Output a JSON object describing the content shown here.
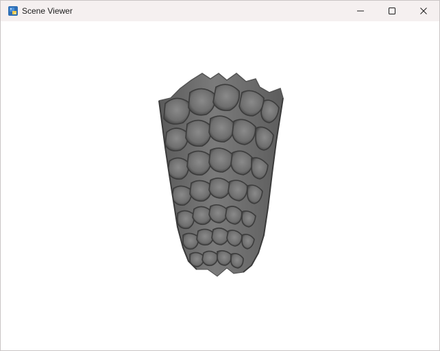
{
  "window": {
    "title": "Scene Viewer",
    "app_icon": "python-app-icon",
    "controls": {
      "minimize_icon": "minimize-icon",
      "maximize_icon": "maximize-icon",
      "close_icon": "close-icon"
    }
  },
  "viewport": {
    "background": "#ffffff",
    "model": {
      "shape": "tapered scalloped vase",
      "surface_color": "#6f6f6f"
    }
  }
}
